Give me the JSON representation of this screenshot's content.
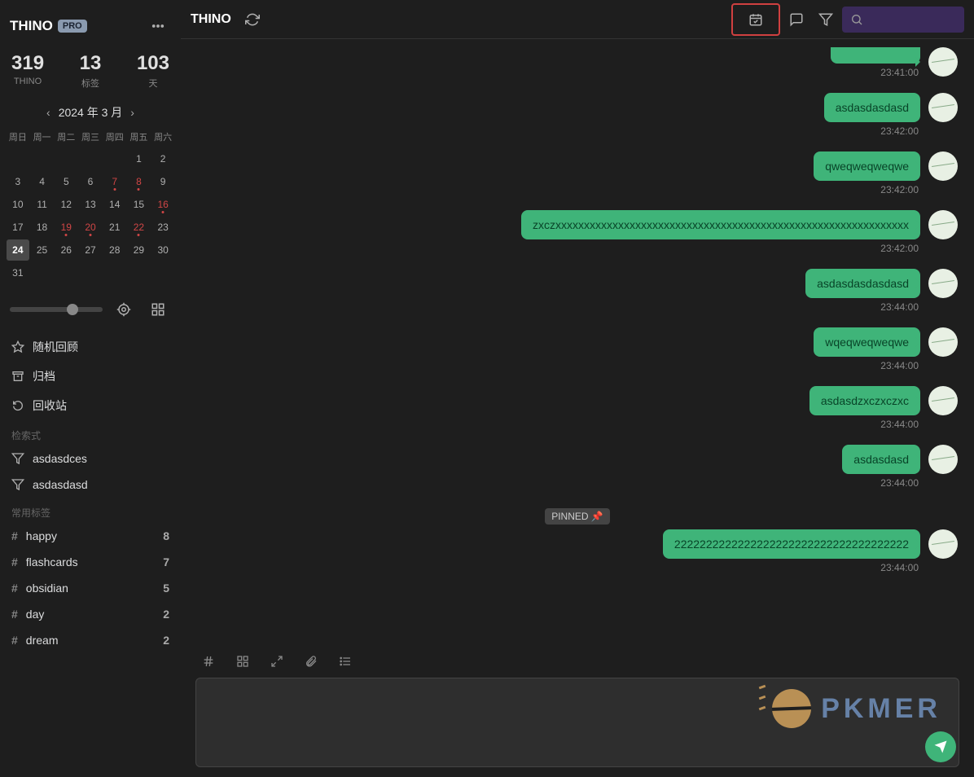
{
  "sidebar": {
    "logo": "THINO",
    "pro": "PRO",
    "stats": [
      {
        "num": "319",
        "label": "THINO"
      },
      {
        "num": "13",
        "label": "标签"
      },
      {
        "num": "103",
        "label": "天"
      }
    ],
    "calendar": {
      "title": "2024 年 3 月",
      "dow": [
        "周日",
        "周一",
        "周二",
        "周三",
        "周四",
        "周五",
        "周六"
      ],
      "weeks": [
        [
          "",
          "",
          "",
          "",
          "",
          "1",
          "2"
        ],
        [
          "3",
          "4",
          "5",
          "6",
          "7",
          "8",
          "9"
        ],
        [
          "10",
          "11",
          "12",
          "13",
          "14",
          "15",
          "16"
        ],
        [
          "17",
          "18",
          "19",
          "20",
          "21",
          "22",
          "23"
        ],
        [
          "24",
          "25",
          "26",
          "27",
          "28",
          "29",
          "30"
        ],
        [
          "31",
          "",
          "",
          "",
          "",
          "",
          ""
        ]
      ],
      "marked": [
        "7",
        "8",
        "16",
        "19",
        "20",
        "22"
      ],
      "today": "24"
    },
    "nav": {
      "random": "随机回顾",
      "archive": "归档",
      "trash": "回收站"
    },
    "filters_label": "检索式",
    "filters": [
      "asdasdces",
      "asdasdasd"
    ],
    "tags_label": "常用标签",
    "tags": [
      {
        "name": "happy",
        "count": "8"
      },
      {
        "name": "flashcards",
        "count": "7"
      },
      {
        "name": "obsidian",
        "count": "5"
      },
      {
        "name": "day",
        "count": "2"
      },
      {
        "name": "dream",
        "count": "2"
      }
    ]
  },
  "main": {
    "title": "THINO",
    "pinned_label": "PINNED",
    "messages": [
      {
        "text": "",
        "time": "23:41:00",
        "empty": true
      },
      {
        "text": "asdasdasdasd",
        "time": "23:42:00"
      },
      {
        "text": "qweqweqweqwe",
        "time": "23:42:00"
      },
      {
        "text": "zxczxxxxxxxxxxxxxxxxxxxxxxxxxxxxxxxxxxxxxxxxxxxxxxxxxxxxxxxxxxxxxx",
        "time": "23:42:00"
      },
      {
        "text": "asdasdasdasdasd",
        "time": "23:44:00"
      },
      {
        "text": "wqeqweqweqwe",
        "time": "23:44:00"
      },
      {
        "text": "asdasdzxczxczxc",
        "time": "23:44:00"
      },
      {
        "text": "asdasdasd",
        "time": "23:44:00"
      }
    ],
    "pinned_message": {
      "text": "2222222222222222222222222222222222222",
      "time": "23:44:00"
    },
    "watermark": "PKMER"
  }
}
